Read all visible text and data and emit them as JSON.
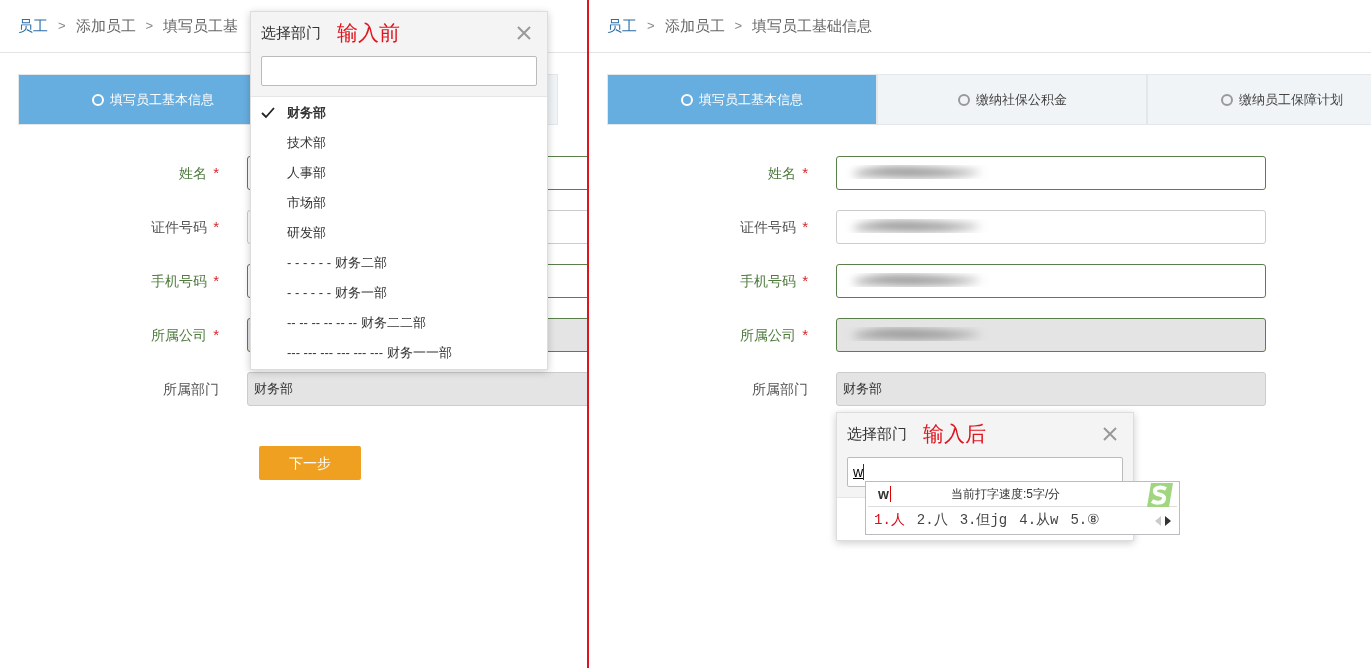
{
  "panels": [
    {
      "breadcrumb": [
        {
          "label": "员工",
          "link": true
        },
        {
          "separator": ">",
          "label": "添加员工",
          "link": false
        },
        {
          "separator": ">",
          "label": "填写员工基",
          "link": false
        }
      ],
      "tabs": [
        {
          "label": "填写员工基本信息",
          "selected": true
        },
        {
          "selected": false
        }
      ],
      "fields": [
        {
          "label": "姓名",
          "required_mark": "*",
          "highlighted": true,
          "readonly": false
        },
        {
          "label": "证件号码",
          "required_mark": "*",
          "highlighted": false,
          "readonly": false
        },
        {
          "label": "手机号码",
          "required_mark": "*",
          "highlighted": true,
          "readonly": false
        },
        {
          "label": "所属公司",
          "required_mark": "*",
          "highlighted": true,
          "readonly": true
        },
        {
          "label": "所属部门",
          "highlighted": false,
          "readonly": true,
          "value": "财务部"
        }
      ],
      "next_button": "下一步",
      "popup": {
        "title": "选择部门",
        "annotation": "输入前",
        "options": [
          {
            "label": "财务部",
            "selected": true
          },
          {
            "label": "技术部",
            "selected": false
          },
          {
            "label": "人事部",
            "selected": false
          },
          {
            "label": "市场部",
            "selected": false
          },
          {
            "label": "研发部",
            "selected": false
          },
          {
            "label": "- - - - - - 财务二部",
            "selected": false
          },
          {
            "label": "- - - - - - 财务一部",
            "selected": false
          },
          {
            "label": "-- -- -- -- -- -- 财务二二部",
            "selected": false
          },
          {
            "label": "--- --- --- --- --- --- 财务一一部",
            "selected": false
          }
        ]
      }
    },
    {
      "breadcrumb": [
        {
          "label": "员工",
          "link": true
        },
        {
          "separator": ">",
          "label": "添加员工",
          "link": false
        },
        {
          "separator": ">",
          "label": "填写员工基础信息",
          "link": false
        }
      ],
      "tabs": [
        {
          "label": "填写员工基本信息",
          "selected": true
        },
        {
          "label": "缴纳社保公积金",
          "selected": false
        },
        {
          "label": "缴纳员工保障计划",
          "selected": false
        }
      ],
      "fields": [
        {
          "label": "姓名",
          "required_mark": "*",
          "highlighted": true,
          "readonly": false,
          "redacted": true
        },
        {
          "label": "证件号码",
          "required_mark": "*",
          "highlighted": false,
          "readonly": false,
          "redacted": true
        },
        {
          "label": "手机号码",
          "required_mark": "*",
          "highlighted": true,
          "readonly": false,
          "redacted": true
        },
        {
          "label": "所属公司",
          "required_mark": "*",
          "highlighted": true,
          "readonly": true,
          "redacted": true
        },
        {
          "label": "所属部门",
          "highlighted": false,
          "readonly": true,
          "value": "财务部"
        }
      ],
      "popup": {
        "title": "选择部门",
        "annotation": "输入后",
        "search_value": "w",
        "ime": {
          "composition": "w",
          "speed": "当前打字速度:5字/分",
          "candidates": [
            {
              "label": "1.人",
              "selected": true
            },
            {
              "label": "2.八",
              "selected": false
            },
            {
              "label": "3.但jg",
              "selected": false
            },
            {
              "label": "4.从w",
              "selected": false
            },
            {
              "label": "5.⑧",
              "selected": false
            }
          ]
        }
      }
    }
  ]
}
